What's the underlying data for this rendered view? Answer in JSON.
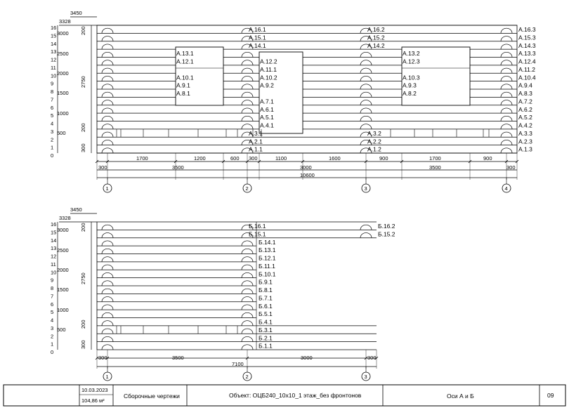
{
  "elevation_a": {
    "top_dims": [
      "3450",
      "3328"
    ],
    "scale": [
      "16",
      "15",
      "14",
      "13",
      "12",
      "11",
      "10",
      "9",
      "8",
      "7",
      "6",
      "5",
      "4",
      "3",
      "2",
      "1",
      "0"
    ],
    "level_marks": [
      "3000",
      "2500",
      "2000",
      "1500",
      "1000",
      "500"
    ],
    "vdims": [
      "200",
      "2750",
      "200",
      "300"
    ],
    "col2_labels": [
      "A.16.1",
      "A.15.1",
      "A.14.1",
      "A.3.1",
      "A.2.1",
      "A.1.1"
    ],
    "col3_labels": [
      "A.16.2",
      "A.15.2",
      "A.14.2",
      "A.3.2",
      "A.2.2",
      "A.1.2"
    ],
    "right_labels": [
      "A.16.3",
      "A.15.3",
      "A.14.3",
      "A.13.3",
      "A.12.4",
      "A.11.2",
      "A.10.4",
      "A.9.4",
      "A.8.3",
      "A.7.2",
      "A.6.2",
      "A.5.2",
      "A.4.2",
      "A.3.3",
      "A.2.3",
      "A.1.3"
    ],
    "win1_labels": [
      "A.13.1",
      "A.12.1",
      "A.10.1",
      "A.9.1",
      "A.8.1"
    ],
    "door_labels": [
      "A.12.2",
      "A.11.1",
      "A.10.2",
      "A.9.2",
      "A.7.1",
      "A.6.1",
      "A.5.1",
      "A.4.1"
    ],
    "win2_labels": [
      "A.13.2",
      "A.12.3",
      "A.10.3",
      "A.9.3",
      "A.8.2"
    ],
    "dims_row1": [
      "1700",
      "1200",
      "600",
      "300",
      "1100",
      "1600",
      "900",
      "1700",
      "900"
    ],
    "dims_row2": [
      "300",
      "3500",
      "3000",
      "3500",
      "300"
    ],
    "total": "10600",
    "axes": [
      "1",
      "2",
      "3",
      "4"
    ]
  },
  "elevation_b": {
    "top_dims": [
      "3450",
      "3328"
    ],
    "scale": [
      "16",
      "15",
      "14",
      "13",
      "12",
      "11",
      "10",
      "9",
      "8",
      "7",
      "6",
      "5",
      "4",
      "3",
      "2",
      "1",
      "0"
    ],
    "level_marks": [
      "3000",
      "2500",
      "2000",
      "1500",
      "1000",
      "500"
    ],
    "vdims": [
      "200",
      "2750",
      "200",
      "300"
    ],
    "col2_labels": [
      "Б.16.1",
      "Б.15.1"
    ],
    "right_labels": [
      "Б.16.2",
      "Б.15.2"
    ],
    "side_labels": [
      "Б.14.1",
      "Б.13.1",
      "Б.12.1",
      "Б.11.1",
      "Б.10.1",
      "Б.9.1",
      "Б.8.1",
      "Б.7.1",
      "Б.6.1",
      "Б.5.1",
      "Б.4.1",
      "Б.3.1",
      "Б.2.1",
      "Б.1.1"
    ],
    "dims_row": [
      "300",
      "3500",
      "3000",
      "300"
    ],
    "total": "7100",
    "axes": [
      "1",
      "2",
      "3"
    ]
  },
  "title_block": {
    "date": "10.03.2023",
    "area": "104,86 м²",
    "doc_type": "Сборочные чертежи",
    "object": "Объект: ОЦБ240_10х10_1 этаж_без фронтонов",
    "axes_text": "Оси А и Б",
    "sheet_no": "09"
  }
}
